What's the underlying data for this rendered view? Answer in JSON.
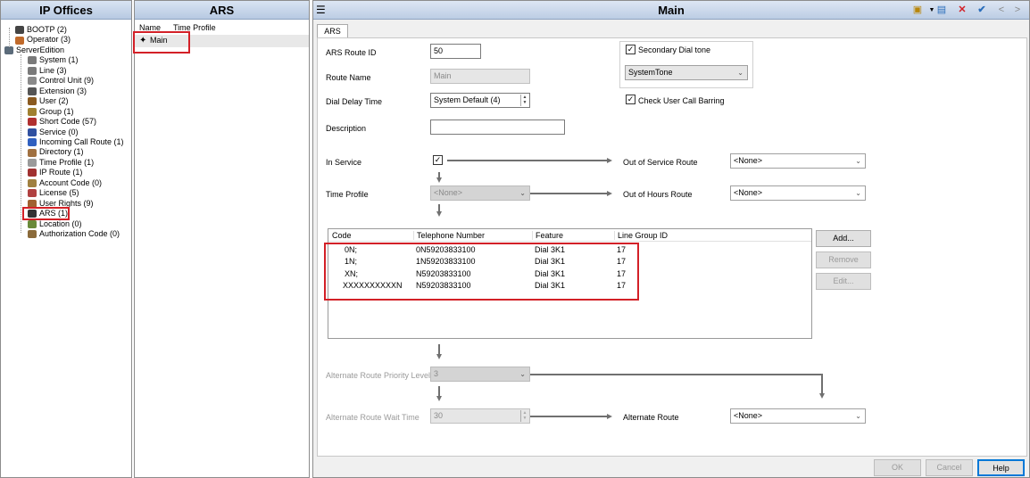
{
  "left_panel": {
    "title": "IP Offices",
    "tree": [
      {
        "label": "BOOTP (2)",
        "icon": "bootp-icon",
        "level": 1
      },
      {
        "label": "Operator (3)",
        "icon": "operator-icon",
        "level": 1
      },
      {
        "label": "ServerEdition",
        "icon": "server-icon",
        "level": 0
      },
      {
        "label": "System (1)",
        "icon": "system-icon",
        "level": 2
      },
      {
        "label": "Line (3)",
        "icon": "line-icon",
        "level": 2
      },
      {
        "label": "Control Unit (9)",
        "icon": "control-unit-icon",
        "level": 2
      },
      {
        "label": "Extension (3)",
        "icon": "extension-icon",
        "level": 2
      },
      {
        "label": "User (2)",
        "icon": "user-icon",
        "level": 2
      },
      {
        "label": "Group (1)",
        "icon": "group-icon",
        "level": 2
      },
      {
        "label": "Short Code (57)",
        "icon": "short-code-icon",
        "level": 2
      },
      {
        "label": "Service (0)",
        "icon": "service-icon",
        "level": 2
      },
      {
        "label": "Incoming Call Route (1)",
        "icon": "incoming-call-route-icon",
        "level": 2
      },
      {
        "label": "Directory (1)",
        "icon": "directory-icon",
        "level": 2
      },
      {
        "label": "Time Profile (1)",
        "icon": "time-profile-icon",
        "level": 2
      },
      {
        "label": "IP Route (1)",
        "icon": "ip-route-icon",
        "level": 2
      },
      {
        "label": "Account Code (0)",
        "icon": "account-code-icon",
        "level": 2
      },
      {
        "label": "License (5)",
        "icon": "license-icon",
        "level": 2
      },
      {
        "label": "User Rights (9)",
        "icon": "user-rights-icon",
        "level": 2
      },
      {
        "label": "ARS (1)",
        "icon": "ars-icon",
        "level": 2
      },
      {
        "label": "Location (0)",
        "icon": "location-icon",
        "level": 2
      },
      {
        "label": "Authorization Code (0)",
        "icon": "authorization-code-icon",
        "level": 2
      }
    ]
  },
  "mid_panel": {
    "title": "ARS",
    "col_name": "Name",
    "col_time_profile": "Time Profile",
    "row_name": "Main"
  },
  "main_panel": {
    "title": "Main",
    "tab": "ARS",
    "ars_route_id_label": "ARS Route ID",
    "ars_route_id": "50",
    "route_name_label": "Route Name",
    "route_name": "Main",
    "dial_delay_label": "Dial Delay Time",
    "dial_delay": "System Default (4)",
    "description_label": "Description",
    "description": "",
    "secondary_dial_tone_label": "Secondary Dial tone",
    "secondary_dial_tone_value": "SystemTone",
    "check_user_call_barring_label": "Check User Call Barring",
    "in_service_label": "In Service",
    "out_of_service_route_label": "Out of Service Route",
    "out_of_service_route": "<None>",
    "time_profile_label": "Time Profile",
    "time_profile": "<None>",
    "out_of_hours_route_label": "Out of Hours Route",
    "out_of_hours_route": "<None>",
    "table": {
      "columns": [
        "Code",
        "Telephone Number",
        "Feature",
        "Line Group ID"
      ],
      "rows": [
        [
          "0N;",
          "0N59203833100",
          "Dial 3K1",
          "17"
        ],
        [
          "1N;",
          "1N59203833100",
          "Dial 3K1",
          "17"
        ],
        [
          "XN;",
          "N59203833100",
          "Dial 3K1",
          "17"
        ],
        [
          "XXXXXXXXXXN",
          "N59203833100",
          "Dial 3K1",
          "17"
        ]
      ]
    },
    "add_button": "Add...",
    "remove_button": "Remove",
    "edit_button": "Edit...",
    "alt_route_priority_label": "Alternate Route Priority Level",
    "alt_route_priority": "3",
    "alt_route_wait_label": "Alternate Route Wait Time",
    "alt_route_wait": "30",
    "alternate_route_label": "Alternate Route",
    "alternate_route": "<None>",
    "ok_button": "OK",
    "cancel_button": "Cancel",
    "help_button": "Help"
  }
}
